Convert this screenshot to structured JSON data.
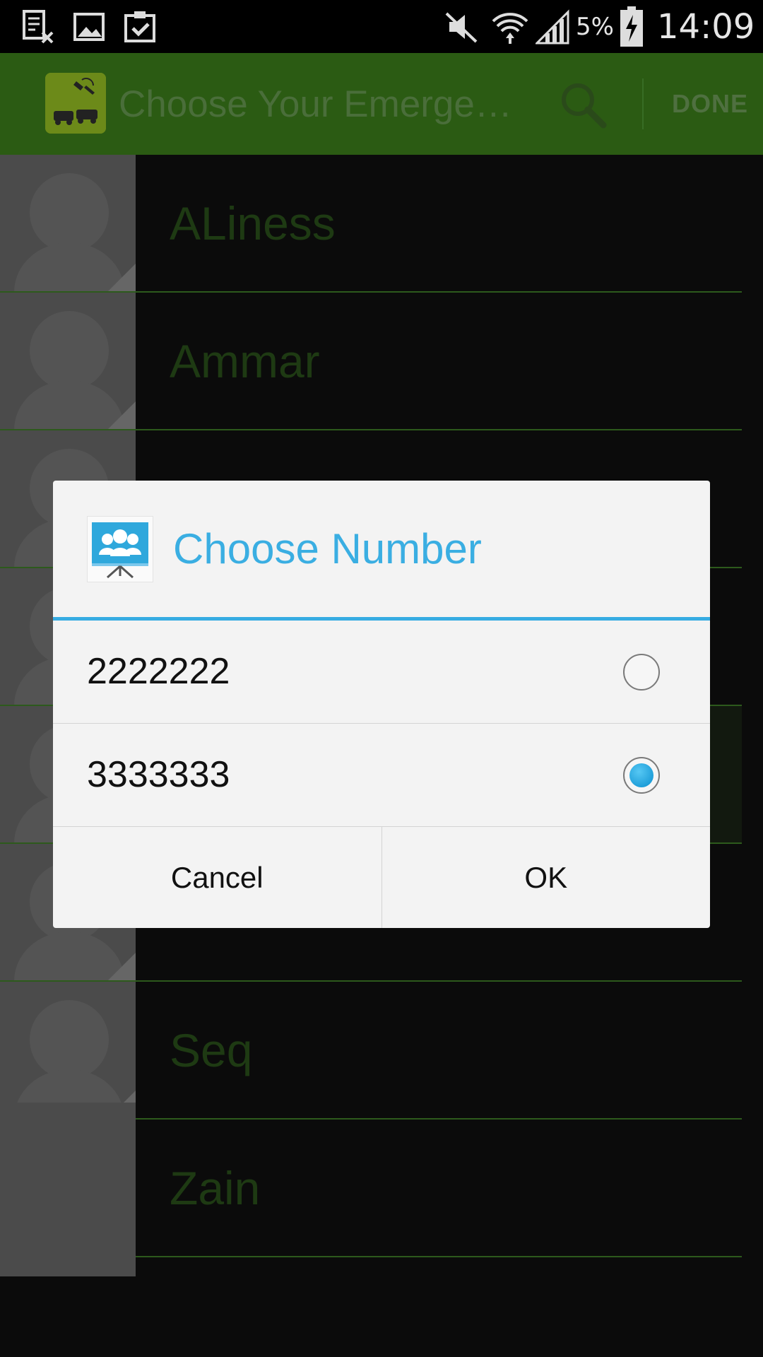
{
  "status_bar": {
    "icons": [
      "sim-card-error-icon",
      "gallery-icon",
      "clipboard-check-icon",
      "mute-icon",
      "wifi-icon",
      "signal-icon",
      "battery-charging-icon"
    ],
    "battery_percent": "5%",
    "time": "14:09"
  },
  "action_bar": {
    "title": "Choose Your Emerge…",
    "search_icon": "search-icon",
    "done_label": "DONE"
  },
  "contacts": [
    {
      "name": "ALiness"
    },
    {
      "name": "Ammar"
    },
    {
      "name": ""
    },
    {
      "name": ""
    },
    {
      "name": ""
    },
    {
      "name": ""
    },
    {
      "name": "Seq"
    },
    {
      "name": "Zain"
    }
  ],
  "dialog": {
    "title": "Choose Number",
    "options": [
      {
        "number": "2222222",
        "selected": false
      },
      {
        "number": "3333333",
        "selected": true
      }
    ],
    "cancel_label": "Cancel",
    "ok_label": "OK"
  },
  "colors": {
    "action_bar_bg": "#2b5b13",
    "dialog_accent": "#36ace2",
    "radio_selected": "#1aa0dd"
  }
}
